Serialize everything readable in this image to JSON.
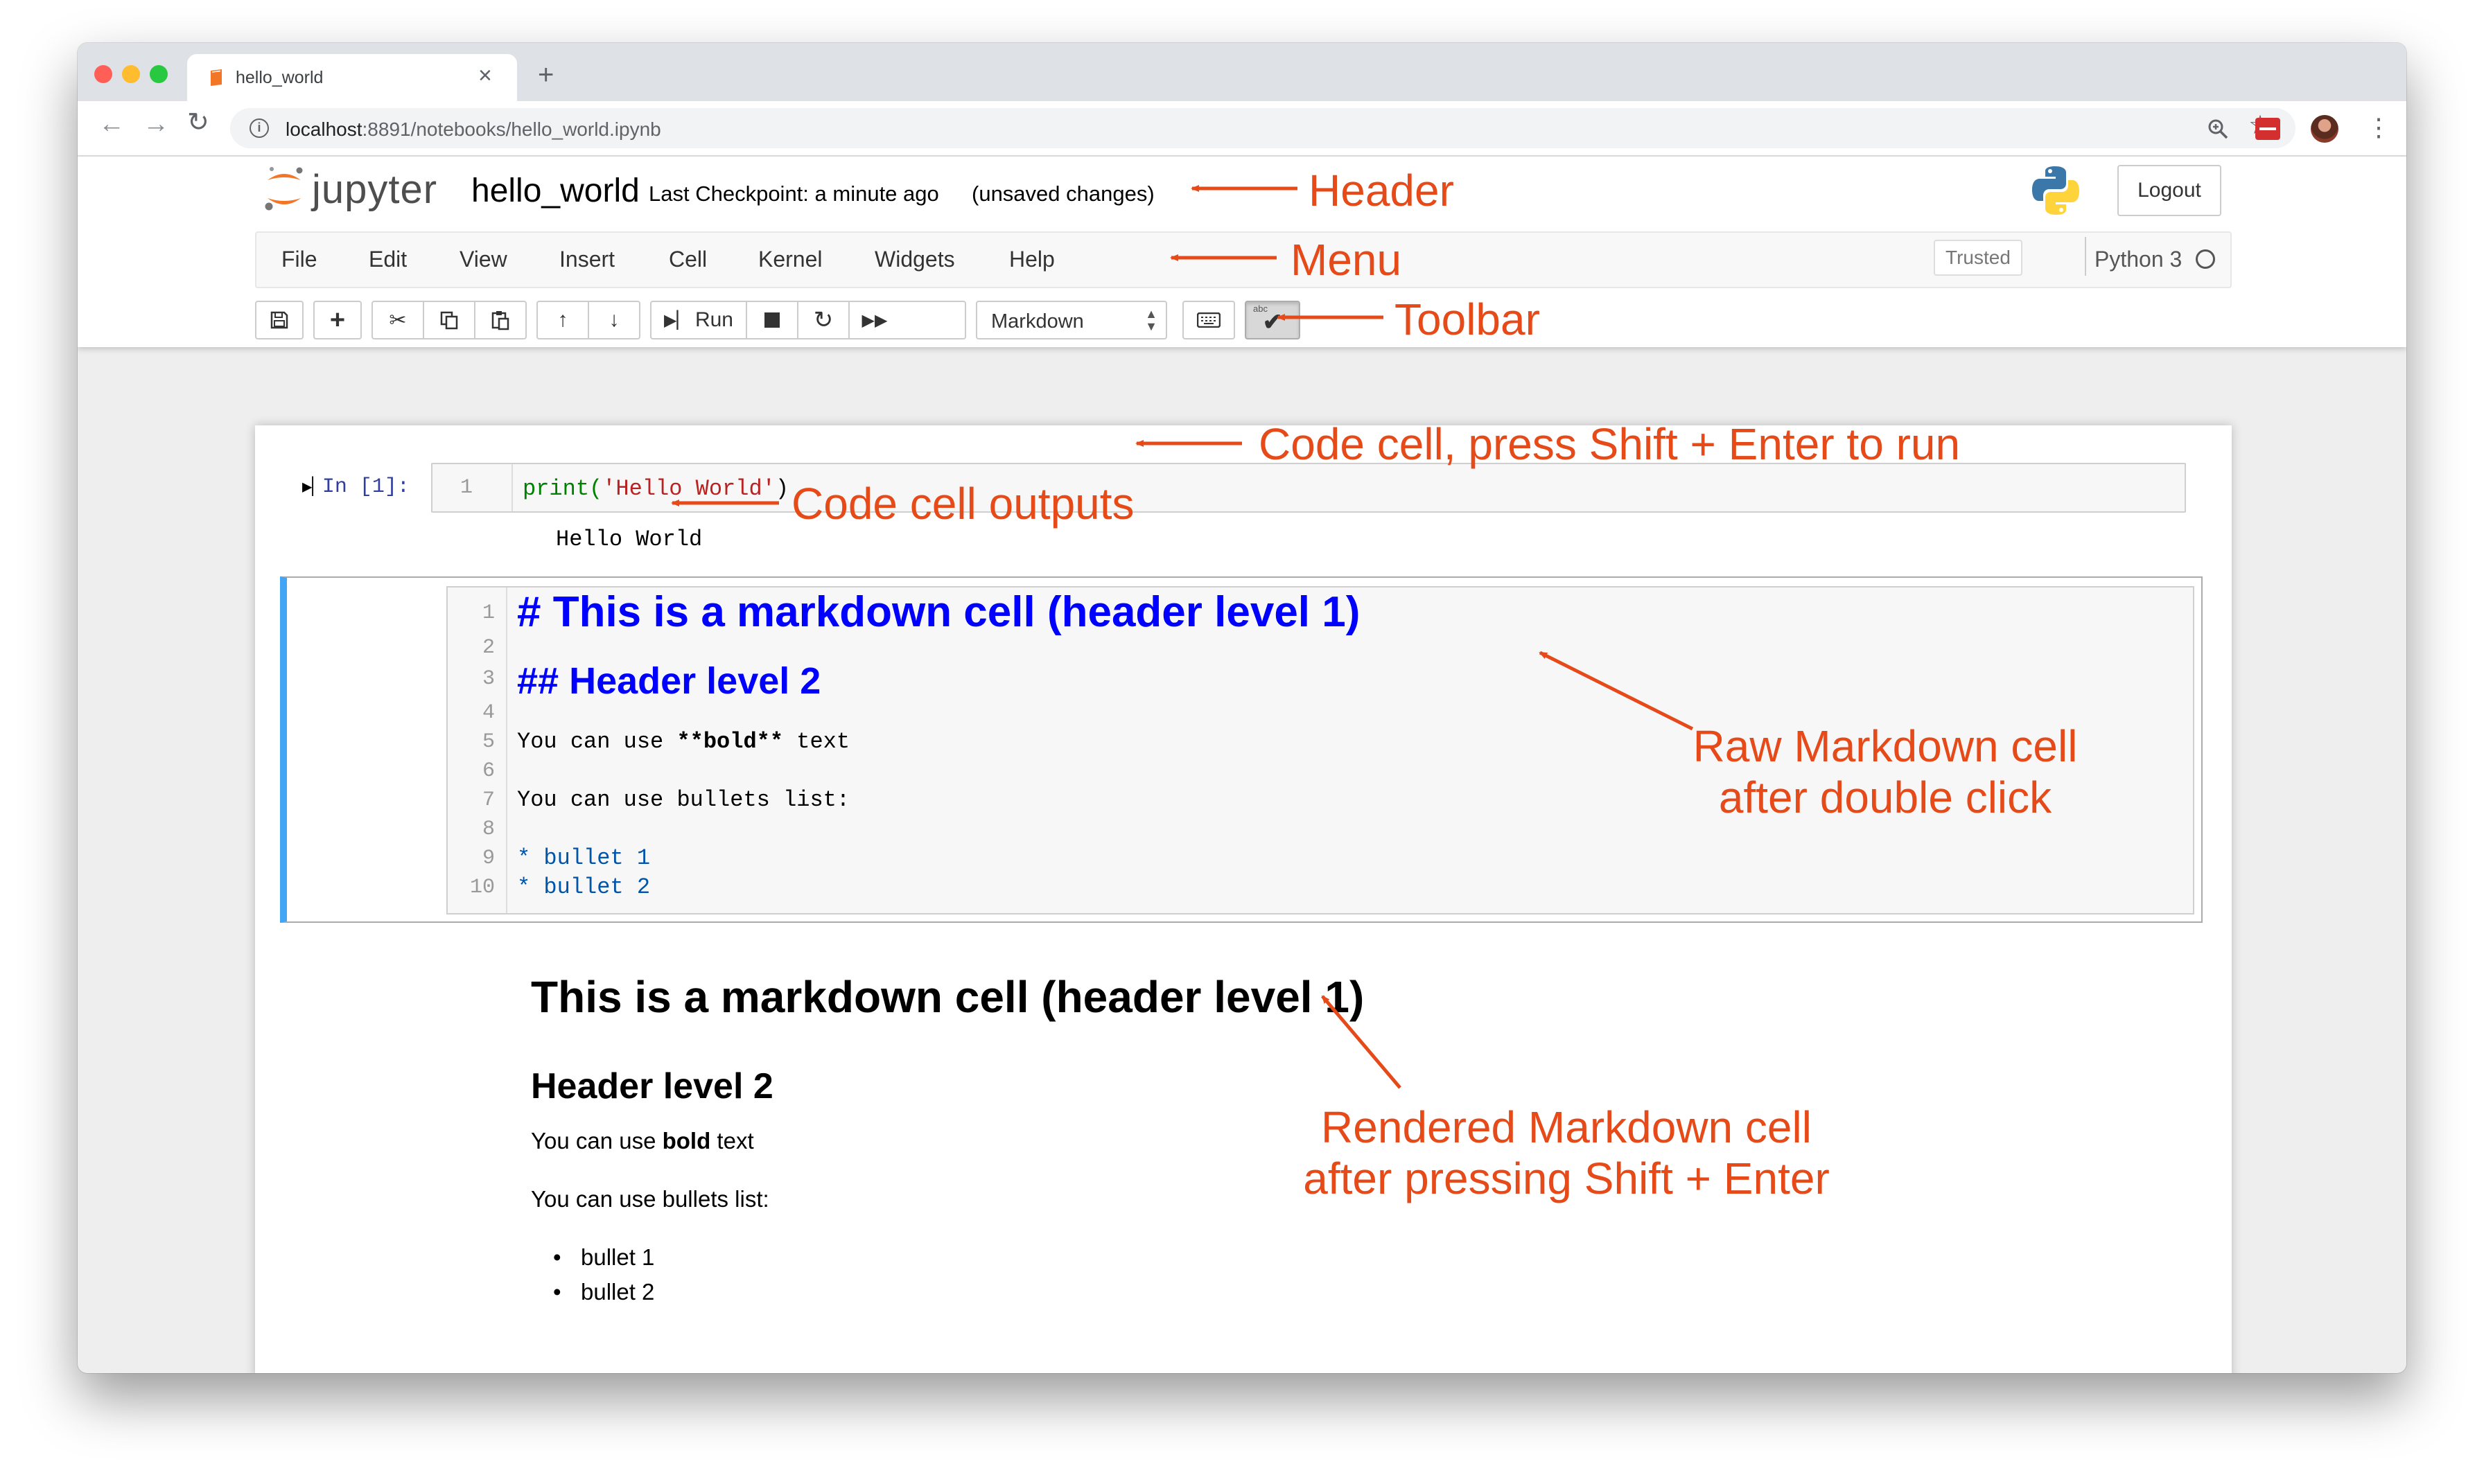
{
  "browser": {
    "tab_title": "hello_world",
    "new_tab": "+",
    "tab_close": "×",
    "url_host": "localhost",
    "url_path": ":8891/notebooks/hello_world.ipynb"
  },
  "jupyter": {
    "logo_text": "jupyter",
    "notebook_name": "hello_world",
    "checkpoint": "Last Checkpoint: a minute ago",
    "unsaved": "(unsaved changes)",
    "logout": "Logout",
    "menu": [
      "File",
      "Edit",
      "View",
      "Insert",
      "Cell",
      "Kernel",
      "Widgets",
      "Help"
    ],
    "trusted": "Trusted",
    "kernel": "Python 3",
    "toolbar": {
      "run_label": "Run",
      "cell_type": "Markdown"
    }
  },
  "code_cell": {
    "prompt": "In [1]:",
    "line_number": "1",
    "code_fn": "print(",
    "code_str": "'Hello World'",
    "code_close": ")",
    "output": "Hello World"
  },
  "markdown_editor": {
    "line_numbers": [
      "1",
      "2",
      "3",
      "4",
      "5",
      "6",
      "7",
      "8",
      "9",
      "10"
    ],
    "h1": "# This is a markdown cell (header level 1)",
    "h2": "## Header level 2",
    "line5_pre": "You can use ",
    "line5_bold": "**bold**",
    "line5_post": " text",
    "line7": "You can use bullets list:",
    "bullet1": "* bullet 1",
    "bullet2": "* bullet 2"
  },
  "rendered_markdown": {
    "h1": "This is a markdown cell (header level 1)",
    "h2": "Header level 2",
    "p1_pre": "You can use ",
    "p1_bold": "bold",
    "p1_post": " text",
    "p2": "You can use bullets list:",
    "bullets": [
      "bullet 1",
      "bullet 2"
    ]
  },
  "annotations": {
    "header": "Header",
    "menu": "Menu",
    "toolbar": "Toolbar",
    "code_cell": "Code cell, press Shift + Enter to run",
    "code_outputs": "Code cell outputs",
    "raw_md_line1": "Raw Markdown cell",
    "raw_md_line2": "after double click",
    "rendered_md_line1": "Rendered Markdown cell",
    "rendered_md_line2": "after pressing Shift + Enter"
  },
  "colors": {
    "annotation": "#e64a19",
    "md_header": "#0000ff",
    "selected_cell_bar": "#42a5f5",
    "jupyter_orange": "#f37626"
  }
}
